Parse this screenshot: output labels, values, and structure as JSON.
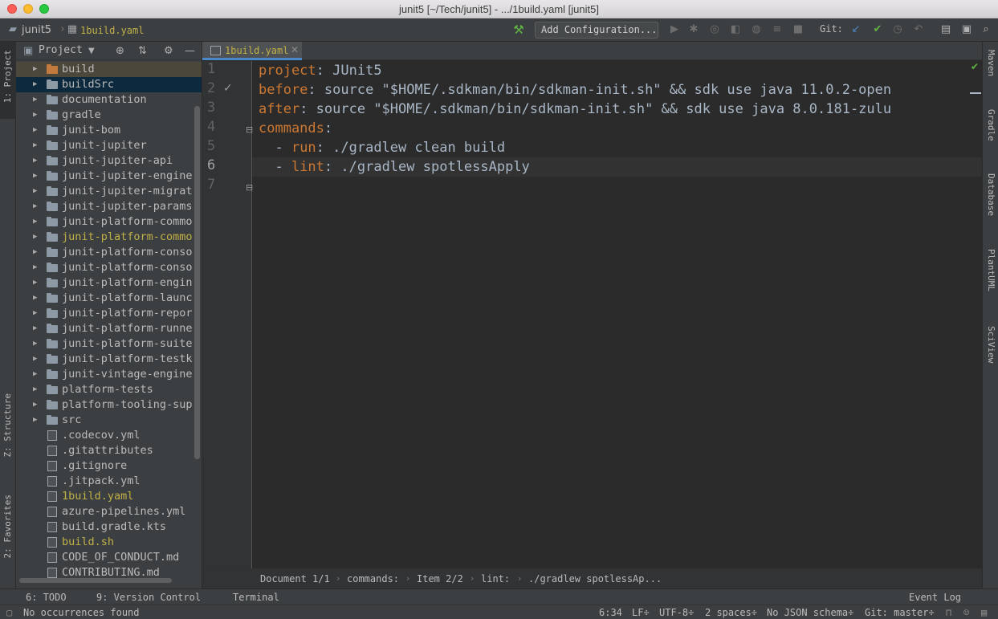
{
  "window": {
    "title": "junit5 [~/Tech/junit5] - .../1build.yaml [junit5]"
  },
  "navbar": {
    "project": "junit5",
    "file": "1build.yaml",
    "add_configuration": "Add Configuration...",
    "git_label": "Git:"
  },
  "left_tabs": {
    "project": "1: Project",
    "structure": "Z: Structure",
    "favorites": "2: Favorites"
  },
  "right_tabs": {
    "maven": "Maven",
    "gradle": "Gradle",
    "database": "Database",
    "plantuml": "PlantUML",
    "sciview": "SciView"
  },
  "project_panel": {
    "title": "Project",
    "items": [
      {
        "label": "build",
        "type": "folder-orange",
        "expandable": true,
        "selected": "brown"
      },
      {
        "label": "buildSrc",
        "type": "folder",
        "expandable": true,
        "selected": "blue"
      },
      {
        "label": "documentation",
        "type": "folder",
        "expandable": true
      },
      {
        "label": "gradle",
        "type": "folder",
        "expandable": true
      },
      {
        "label": "junit-bom",
        "type": "folder",
        "expandable": true
      },
      {
        "label": "junit-jupiter",
        "type": "folder",
        "expandable": true
      },
      {
        "label": "junit-jupiter-api",
        "type": "folder",
        "expandable": true
      },
      {
        "label": "junit-jupiter-engine",
        "type": "folder",
        "expandable": true
      },
      {
        "label": "junit-jupiter-migrat",
        "type": "folder",
        "expandable": true
      },
      {
        "label": "junit-jupiter-params",
        "type": "folder",
        "expandable": true
      },
      {
        "label": "junit-platform-commo",
        "type": "folder",
        "expandable": true
      },
      {
        "label": "junit-platform-commo",
        "type": "folder",
        "expandable": true,
        "yellow": true
      },
      {
        "label": "junit-platform-conso",
        "type": "folder",
        "expandable": true
      },
      {
        "label": "junit-platform-conso",
        "type": "folder",
        "expandable": true
      },
      {
        "label": "junit-platform-engin",
        "type": "folder",
        "expandable": true
      },
      {
        "label": "junit-platform-launc",
        "type": "folder",
        "expandable": true
      },
      {
        "label": "junit-platform-repor",
        "type": "folder",
        "expandable": true
      },
      {
        "label": "junit-platform-runne",
        "type": "folder",
        "expandable": true
      },
      {
        "label": "junit-platform-suite",
        "type": "folder",
        "expandable": true
      },
      {
        "label": "junit-platform-testk",
        "type": "folder",
        "expandable": true
      },
      {
        "label": "junit-vintage-engine",
        "type": "folder",
        "expandable": true
      },
      {
        "label": "platform-tests",
        "type": "folder",
        "expandable": true
      },
      {
        "label": "platform-tooling-sup",
        "type": "folder",
        "expandable": true
      },
      {
        "label": "src",
        "type": "folder",
        "expandable": true
      },
      {
        "label": ".codecov.yml",
        "type": "file"
      },
      {
        "label": ".gitattributes",
        "type": "file"
      },
      {
        "label": ".gitignore",
        "type": "file"
      },
      {
        "label": ".jitpack.yml",
        "type": "file"
      },
      {
        "label": "1build.yaml",
        "type": "file",
        "yellow": true
      },
      {
        "label": "azure-pipelines.yml",
        "type": "file"
      },
      {
        "label": "build.gradle.kts",
        "type": "file"
      },
      {
        "label": "build.sh",
        "type": "file",
        "yellow": true
      },
      {
        "label": "CODE_OF_CONDUCT.md",
        "type": "file"
      },
      {
        "label": "CONTRIBUTING.md",
        "type": "file"
      }
    ]
  },
  "editor": {
    "tab": "1build.yaml",
    "line_numbers": [
      "1",
      "2",
      "3",
      "4",
      "5",
      "6",
      "7"
    ],
    "lines": [
      {
        "key": "project",
        "sep": ": ",
        "value": "JUnit5"
      },
      {
        "key": "before",
        "sep": ": ",
        "value": "source \"$HOME/.sdkman/bin/sdkman-init.sh\" && sdk use java 11.0.2-open"
      },
      {
        "key": "after",
        "sep": ": ",
        "value": "source \"$HOME/.sdkman/bin/sdkman-init.sh\" && sdk use java 8.0.181-zulu"
      },
      {
        "key": "commands",
        "sep": ":",
        "value": ""
      },
      {
        "dash": "  - ",
        "key": "run",
        "sep": ": ",
        "value": "./gradlew clean build"
      },
      {
        "dash": "  - ",
        "key": "lint",
        "sep": ": ",
        "value": "./gradlew spotlessApply"
      },
      {
        "key": "",
        "sep": "",
        "value": ""
      }
    ],
    "breadcrumbs": [
      "Document 1/1",
      "commands:",
      "Item 2/2",
      "lint:",
      "./gradlew spotlessAp..."
    ]
  },
  "bottom_tools": {
    "todo": "6: TODO",
    "vcs": "9: Version Control",
    "terminal": "Terminal",
    "event_log": "Event Log"
  },
  "status": {
    "message": "No occurrences found",
    "position": "6:34",
    "line_sep": "LF÷",
    "encoding": "UTF-8÷",
    "indent": "2 spaces÷",
    "schema": "No JSON schema÷",
    "git": "Git: master÷"
  },
  "colors": {
    "accent": "#4a88c7",
    "keyword": "#cc7832",
    "text": "#a9b7c6",
    "modified": "#c1b048"
  }
}
